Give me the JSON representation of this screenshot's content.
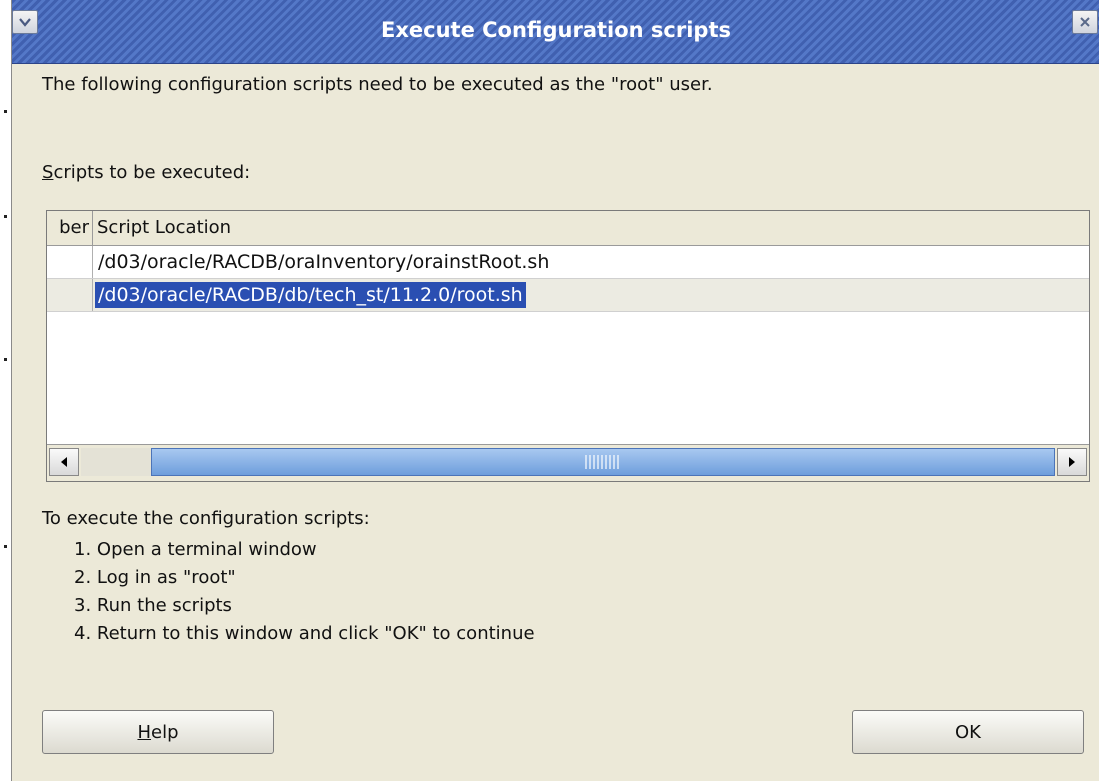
{
  "window": {
    "title": "Execute Configuration scripts"
  },
  "intro_text": "The following configuration scripts need to be executed as the \"root\" user.",
  "scripts_label": {
    "accel": "S",
    "rest": "cripts to be executed:"
  },
  "table": {
    "columns": [
      "ber",
      "Script Location"
    ],
    "rows": [
      {
        "number": "",
        "location": "/d03/oracle/RACDB/oraInventory/orainstRoot.sh",
        "selected": false
      },
      {
        "number": "",
        "location": "/d03/oracle/RACDB/db/tech_st/11.2.0/root.sh",
        "selected": true
      }
    ]
  },
  "instructions": {
    "title": "To execute the configuration scripts:",
    "steps": [
      "1. Open a terminal window",
      "2. Log in as \"root\"",
      "3. Run the scripts",
      "4. Return to this window and click \"OK\" to continue"
    ]
  },
  "buttons": {
    "help": {
      "accel": "H",
      "rest": "elp"
    },
    "ok": "OK"
  },
  "icons": {
    "window_menu": "chevron-down-icon",
    "close": "close-icon",
    "scroll_left": "arrow-left-icon",
    "scroll_right": "arrow-right-icon"
  },
  "colors": {
    "titlebar": "#4a6cbc",
    "dialog_bg": "#ece9d8",
    "selection": "#2a4fb2"
  }
}
